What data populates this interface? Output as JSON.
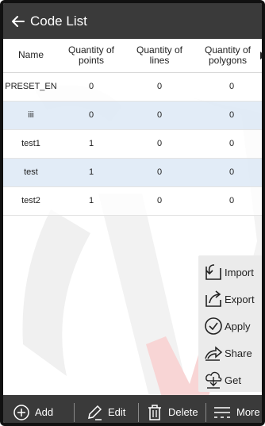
{
  "header": {
    "title": "Code List",
    "back_icon": "arrow-left-icon"
  },
  "table": {
    "columns": [
      "Name",
      "Quantity of points",
      "Quantity of lines",
      "Quantity of polygons"
    ],
    "rows": [
      {
        "name": "PRESET_EN",
        "points": "0",
        "lines": "0",
        "polygons": "0"
      },
      {
        "name": "iii",
        "points": "0",
        "lines": "0",
        "polygons": "0"
      },
      {
        "name": "test1",
        "points": "1",
        "lines": "0",
        "polygons": "0"
      },
      {
        "name": "test",
        "points": "1",
        "lines": "0",
        "polygons": "0"
      },
      {
        "name": "test2",
        "points": "1",
        "lines": "0",
        "polygons": "0"
      }
    ],
    "highlight_color": "#dfeaf6"
  },
  "popup_menu": {
    "items": [
      {
        "label": "Import",
        "icon": "import-icon"
      },
      {
        "label": "Export",
        "icon": "export-icon"
      },
      {
        "label": "Apply",
        "icon": "check-circle-icon"
      },
      {
        "label": "Share",
        "icon": "share-icon"
      },
      {
        "label": "Get",
        "icon": "download-icon"
      }
    ]
  },
  "toolbar": {
    "add_label": "Add",
    "edit_label": "Edit",
    "delete_label": "Delete",
    "more_label": "More"
  },
  "colors": {
    "bar_bg": "#3a3a3a",
    "watermark": "#e53935"
  }
}
